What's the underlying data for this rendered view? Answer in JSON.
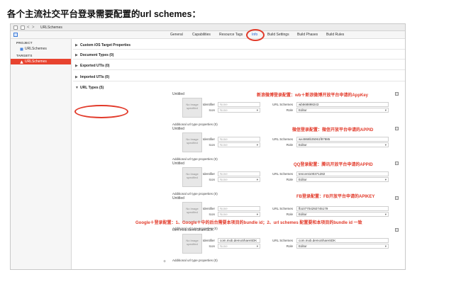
{
  "caption": "各个主流社交平台登录需要配置的url schemes：",
  "toolbar": {
    "file_name": "URLSchemes",
    "back": "<",
    "forward": ">"
  },
  "tabs": [
    {
      "label": "General"
    },
    {
      "label": "Capabilities"
    },
    {
      "label": "Resource Tags"
    },
    {
      "label": "Info"
    },
    {
      "label": "Build Settings"
    },
    {
      "label": "Build Phases"
    },
    {
      "label": "Build Rules"
    }
  ],
  "active_tab": "Info",
  "sidebar": {
    "project_header": "PROJECT",
    "project_item": "URLSchemes",
    "targets_header": "TARGETS",
    "target_item": "URLSchemes"
  },
  "sections": [
    {
      "title": "Custom iOS Target Properties"
    },
    {
      "title": "Document Types (0)"
    },
    {
      "title": "Exported UTIs (0)"
    },
    {
      "title": "Imported UTIs (0)"
    },
    {
      "title": "URL Types (5)"
    }
  ],
  "field_labels": {
    "identifier": "Identifier",
    "icon": "Icon",
    "url_schemes": "URL Schemes",
    "role": "Role",
    "none": "None",
    "no_image": "No Image specified",
    "additional": "Additional url type properties (0)",
    "minus": "−",
    "add": "+"
  },
  "url_types": [
    {
      "name": "Untitled",
      "identifier": "",
      "url_schemes": "wb568898243",
      "role": "Editor",
      "note": "新浪微博登录配置：wb＋新浪微博开放平台申请的AppKey"
    },
    {
      "name": "Untitled",
      "identifier": "",
      "url_schemes": "wx4868b35061f87885",
      "role": "Editor",
      "note": "微信登录配置：微信开放平台申请的APPID"
    },
    {
      "name": "Untitled",
      "identifier": "",
      "url_schemes": "tencent100371282",
      "role": "Editor",
      "note": "QQ登录配置：腾讯开放平台申请的APPID"
    },
    {
      "name": "Untitled",
      "identifier": "",
      "url_schemes": "fb107704292745179",
      "role": "Editor",
      "note": "FB登录配置：FB开放平台申请的APIKEY"
    },
    {
      "name": "com.mob.demoShareSDK",
      "identifier": "com.mob.demoShareSDK",
      "url_schemes": "com.mob.demoShareSDK",
      "role": "Editor",
      "note": "Google＋登录配置：1、Google＋中的后台需要本项目的bundle id；2、url schemes 配置要和本项目的bundle id 一致"
    }
  ],
  "colors": {
    "annotation": "#e23a2a",
    "selection": "#e8432f",
    "active_tab": "#1c62d6"
  }
}
